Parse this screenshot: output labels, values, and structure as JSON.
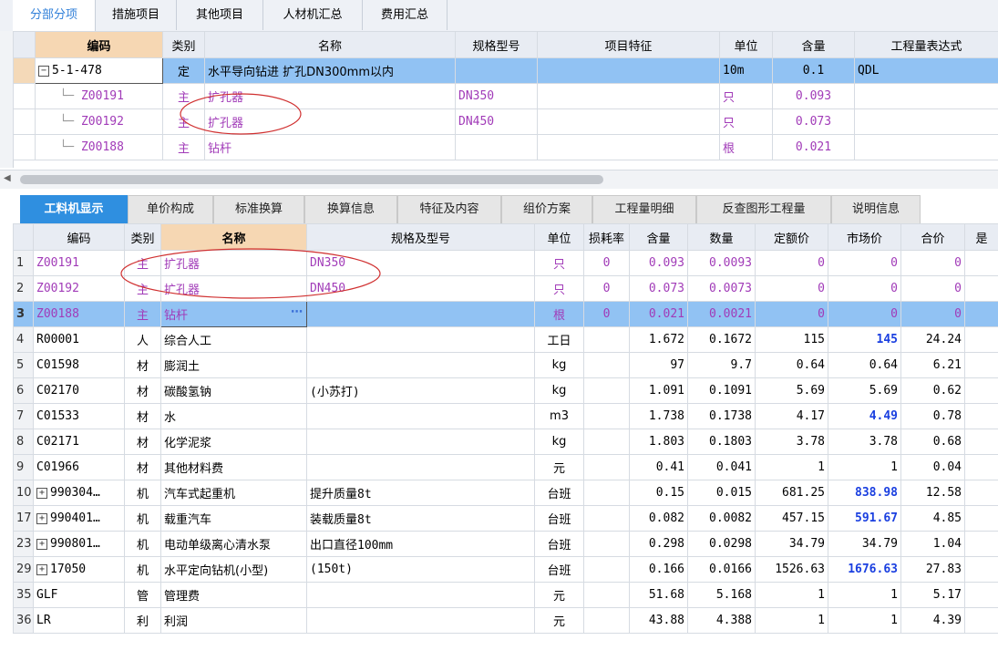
{
  "top_tabs": [
    "分部分项",
    "措施项目",
    "其他项目",
    "人材机汇总",
    "费用汇总"
  ],
  "upper_table": {
    "headers": [
      "编码",
      "类别",
      "名称",
      "规格型号",
      "项目特征",
      "单位",
      "含量",
      "工程量表达式"
    ],
    "rows": [
      {
        "code": "5-1-478",
        "type": "定",
        "name": "水平导向钻进 扩孔DN300mm以内",
        "spec": "",
        "feature": "",
        "unit": "10m",
        "amount": "0.1",
        "expr": "QDL"
      },
      {
        "code": "Z00191",
        "type": "主",
        "name": "扩孔器",
        "spec": "DN350",
        "feature": "",
        "unit": "只",
        "amount": "0.093",
        "expr": ""
      },
      {
        "code": "Z00192",
        "type": "主",
        "name": "扩孔器",
        "spec": "DN450",
        "feature": "",
        "unit": "只",
        "amount": "0.073",
        "expr": ""
      },
      {
        "code": "Z00188",
        "type": "主",
        "name": "钻杆",
        "spec": "",
        "feature": "",
        "unit": "根",
        "amount": "0.021",
        "expr": ""
      }
    ]
  },
  "bottom_tabs": [
    "工料机显示",
    "单价构成",
    "标准换算",
    "换算信息",
    "特征及内容",
    "组价方案",
    "工程量明细",
    "反查图形工程量",
    "说明信息"
  ],
  "lower_table": {
    "headers": [
      "编码",
      "类别",
      "名称",
      "规格及型号",
      "单位",
      "损耗率",
      "含量",
      "数量",
      "定额价",
      "市场价",
      "合价",
      "是"
    ],
    "rows": [
      {
        "no": "1",
        "code": "Z00191",
        "type": "主",
        "name": "扩孔器",
        "spec": "DN350",
        "unit": "只",
        "loss": "0",
        "amount": "0.093",
        "qty": "0.0093",
        "quota": "0",
        "market": "0",
        "total": "0"
      },
      {
        "no": "2",
        "code": "Z00192",
        "type": "主",
        "name": "扩孔器",
        "spec": "DN450",
        "unit": "只",
        "loss": "0",
        "amount": "0.073",
        "qty": "0.0073",
        "quota": "0",
        "market": "0",
        "total": "0"
      },
      {
        "no": "3",
        "code": "Z00188",
        "type": "主",
        "name": "钻杆",
        "spec": "",
        "unit": "根",
        "loss": "0",
        "amount": "0.021",
        "qty": "0.0021",
        "quota": "0",
        "market": "0",
        "total": "0"
      },
      {
        "no": "4",
        "code": "R00001",
        "type": "人",
        "name": "综合人工",
        "spec": "",
        "unit": "工日",
        "loss": "",
        "amount": "1.672",
        "qty": "0.1672",
        "quota": "115",
        "market": "145",
        "total": "24.24"
      },
      {
        "no": "5",
        "code": "C01598",
        "type": "材",
        "name": "膨润土",
        "spec": "",
        "unit": "kg",
        "loss": "",
        "amount": "97",
        "qty": "9.7",
        "quota": "0.64",
        "market": "0.64",
        "total": "6.21"
      },
      {
        "no": "6",
        "code": "C02170",
        "type": "材",
        "name": "碳酸氢钠",
        "spec": "(小苏打)",
        "unit": "kg",
        "loss": "",
        "amount": "1.091",
        "qty": "0.1091",
        "quota": "5.69",
        "market": "5.69",
        "total": "0.62"
      },
      {
        "no": "7",
        "code": "C01533",
        "type": "材",
        "name": "水",
        "spec": "",
        "unit": "m3",
        "loss": "",
        "amount": "1.738",
        "qty": "0.1738",
        "quota": "4.17",
        "market": "4.49",
        "total": "0.78"
      },
      {
        "no": "8",
        "code": "C02171",
        "type": "材",
        "name": "化学泥浆",
        "spec": "",
        "unit": "kg",
        "loss": "",
        "amount": "1.803",
        "qty": "0.1803",
        "quota": "3.78",
        "market": "3.78",
        "total": "0.68"
      },
      {
        "no": "9",
        "code": "C01966",
        "type": "材",
        "name": "其他材料费",
        "spec": "",
        "unit": "元",
        "loss": "",
        "amount": "0.41",
        "qty": "0.041",
        "quota": "1",
        "market": "1",
        "total": "0.04"
      },
      {
        "no": "10",
        "code": "990304…",
        "type": "机",
        "name": "汽车式起重机",
        "spec": "提升质量8t",
        "unit": "台班",
        "loss": "",
        "amount": "0.15",
        "qty": "0.015",
        "quota": "681.25",
        "market": "838.98",
        "total": "12.58"
      },
      {
        "no": "17",
        "code": "990401…",
        "type": "机",
        "name": "载重汽车",
        "spec": "装载质量8t",
        "unit": "台班",
        "loss": "",
        "amount": "0.082",
        "qty": "0.0082",
        "quota": "457.15",
        "market": "591.67",
        "total": "4.85"
      },
      {
        "no": "23",
        "code": "990801…",
        "type": "机",
        "name": "电动单级离心清水泵",
        "spec": "出口直径100mm",
        "unit": "台班",
        "loss": "",
        "amount": "0.298",
        "qty": "0.0298",
        "quota": "34.79",
        "market": "34.79",
        "total": "1.04"
      },
      {
        "no": "29",
        "code": "17050",
        "type": "机",
        "name": "水平定向钻机(小型)",
        "spec": "(150t)",
        "unit": "台班",
        "loss": "",
        "amount": "0.166",
        "qty": "0.0166",
        "quota": "1526.63",
        "market": "1676.63",
        "total": "27.83"
      },
      {
        "no": "35",
        "code": "GLF",
        "type": "管",
        "name": "管理费",
        "spec": "",
        "unit": "元",
        "loss": "",
        "amount": "51.68",
        "qty": "5.168",
        "quota": "1",
        "market": "1",
        "total": "5.17"
      },
      {
        "no": "36",
        "code": "LR",
        "type": "利",
        "name": "利润",
        "spec": "",
        "unit": "元",
        "loss": "",
        "amount": "43.88",
        "qty": "4.388",
        "quota": "1",
        "market": "1",
        "total": "4.39"
      }
    ]
  },
  "colors": {
    "selected_row": "#91c2f3",
    "main_material": "#a13bb8",
    "highlight_price": "#1a3fe0",
    "active_tab": "#2f8fe0",
    "annotation": "#d03030"
  }
}
